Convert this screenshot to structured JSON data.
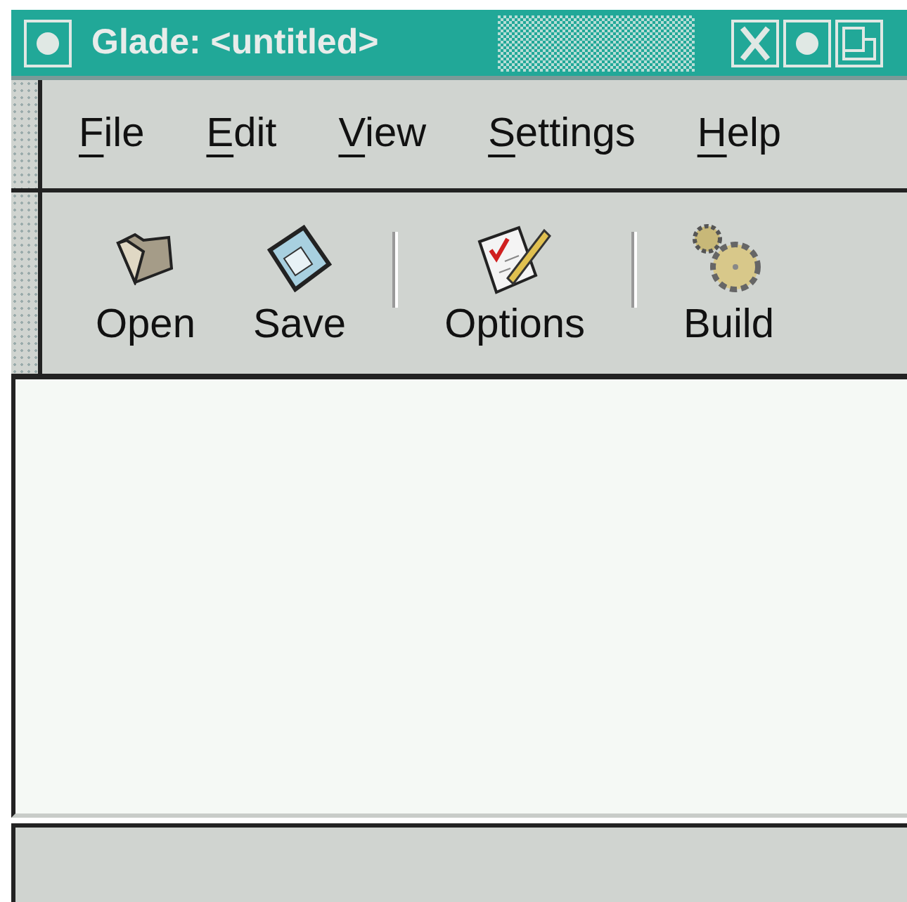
{
  "window": {
    "title": "Glade: <untitled>"
  },
  "menu": [
    {
      "label": "File"
    },
    {
      "label": "Edit"
    },
    {
      "label": "View"
    },
    {
      "label": "Settings"
    },
    {
      "label": "Help"
    }
  ],
  "toolbar": [
    {
      "kind": "button",
      "label": "Open"
    },
    {
      "kind": "button",
      "label": "Save"
    },
    {
      "kind": "separator"
    },
    {
      "kind": "button",
      "label": "Options"
    },
    {
      "kind": "separator"
    },
    {
      "kind": "button",
      "label": "Build"
    }
  ]
}
